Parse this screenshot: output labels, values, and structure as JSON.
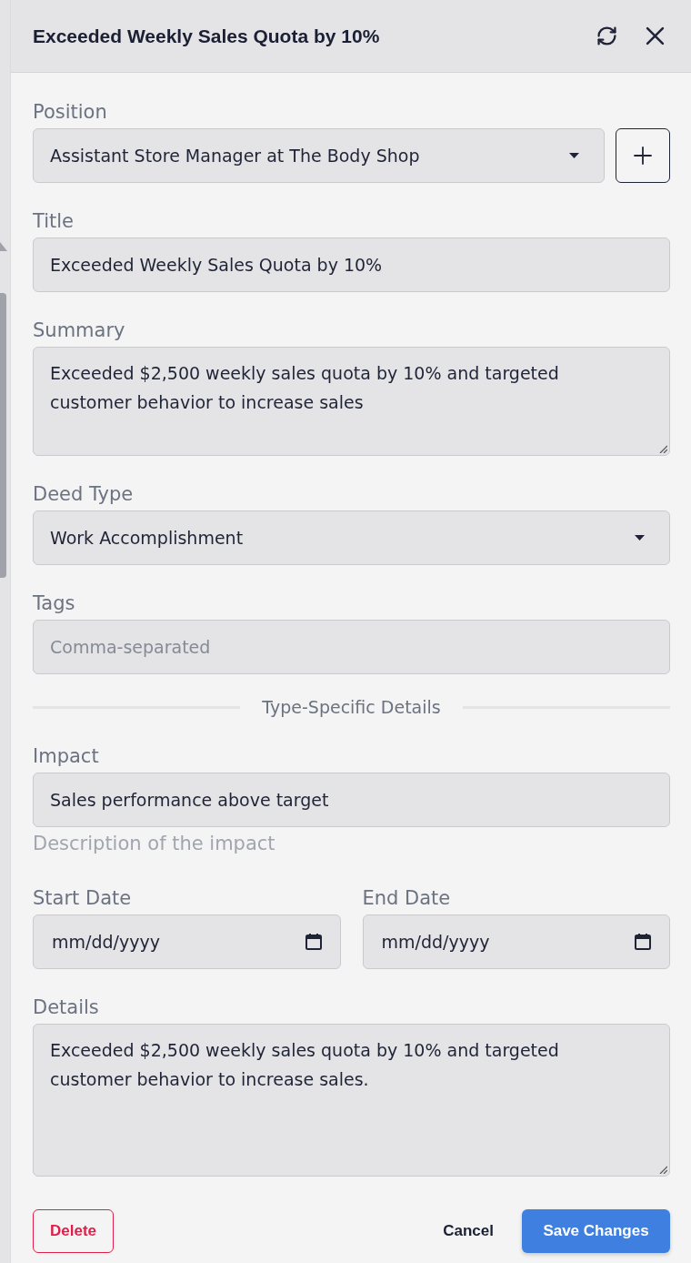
{
  "header": {
    "title": "Exceeded Weekly Sales Quota by 10%"
  },
  "fields": [
    {
      "kind": "select",
      "label": "Position",
      "value": "Assistant Store Manager at The Body Shop",
      "add_button": true
    },
    {
      "kind": "text",
      "label": "Title",
      "value": "Exceeded Weekly Sales Quota by 10%"
    },
    {
      "kind": "textarea",
      "label": "Summary",
      "value": "Exceeded $2,500 weekly sales quota by 10% and targeted customer behavior to increase sales"
    },
    {
      "kind": "select",
      "label": "Deed Type",
      "value": "Work Accomplishment"
    },
    {
      "kind": "text",
      "label": "Tags",
      "placeholder": "Comma-separated"
    }
  ],
  "section": {
    "title": "Type-Specific Details",
    "fields": [
      {
        "kind": "text",
        "label": "Impact",
        "value": "Sales performance above target",
        "hint": "Description of the impact"
      },
      {
        "kind": "date",
        "label": "Start Date",
        "placeholder": "mm/dd/yyyy"
      },
      {
        "kind": "date",
        "label": "End Date",
        "placeholder": "mm/dd/yyyy"
      },
      {
        "kind": "textarea",
        "label": "Details",
        "value": "Exceeded $2,500 weekly sales quota by 10% and targeted customer behavior to increase sales."
      }
    ]
  },
  "actions": [
    {
      "kind": "danger",
      "label": "Delete"
    },
    {
      "kind": "plain",
      "label": "Cancel"
    },
    {
      "kind": "primary",
      "label": "Save Changes"
    }
  ]
}
